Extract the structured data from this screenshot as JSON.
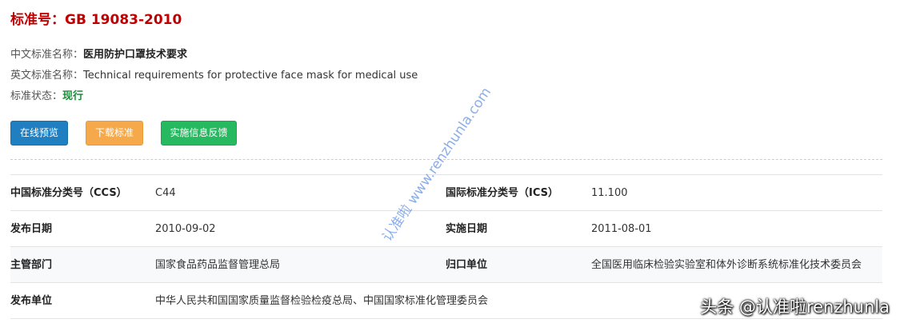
{
  "header": {
    "title": "标准号：GB 19083-2010"
  },
  "meta": {
    "cn_name_label": "中文标准名称：",
    "cn_name_value": "医用防护口罩技术要求",
    "en_name_label": "英文标准名称：",
    "en_name_value": "Technical requirements for protective face mask for medical use",
    "status_label": "标准状态：",
    "status_value": "现行"
  },
  "buttons": {
    "preview": "在线预览",
    "download": "下载标准",
    "feedback": "实施信息反馈"
  },
  "table": {
    "rows": [
      {
        "k1": "中国标准分类号（CCS）",
        "v1": "C44",
        "k2": "国际标准分类号（ICS）",
        "v2": "11.100"
      },
      {
        "k1": "发布日期",
        "v1": "2010-09-02",
        "k2": "实施日期",
        "v2": "2011-08-01"
      },
      {
        "k1": "主管部门",
        "v1": "国家食品药品监督管理总局",
        "k2": "归口单位",
        "v2": "全国医用临床检验实验室和体外诊断系统标准化技术委员会"
      },
      {
        "k1": "发布单位",
        "v1": "中华人民共和国国家质量监督检验检疫总局、中国国家标准化管理委员会",
        "k2": "",
        "v2": ""
      }
    ]
  },
  "watermark": "认准啦 www.renzhunla.com",
  "credit": "头条 @认准啦renzhunla",
  "colors": {
    "title_red": "#c00000",
    "status_green": "#1f8a3a",
    "btn_blue": "#1f7fc1",
    "btn_orange": "#f5a94a",
    "btn_green": "#27b960"
  }
}
